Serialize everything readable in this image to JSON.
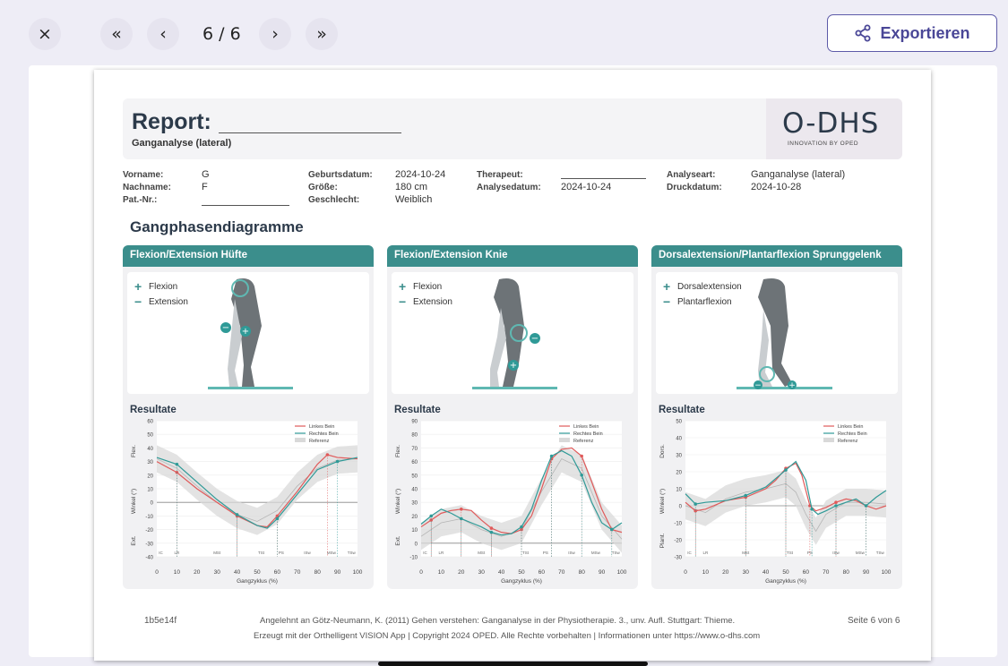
{
  "toolbar": {
    "close": "×",
    "first": "«",
    "prev": "‹",
    "page": "6 / 6",
    "next": "›",
    "last": "»",
    "export_label": "Exportieren"
  },
  "report": {
    "title": "Report:",
    "subtitle": "Ganganalyse (lateral)",
    "logo": "O-DHS",
    "logo_sub": "INNOVATION BY OPED",
    "info": {
      "vorname_label": "Vorname:",
      "vorname": "G",
      "nachname_label": "Nachname:",
      "nachname": "F",
      "patnr_label": "Pat.-Nr.:",
      "geburtsdatum_label": "Geburtsdatum:",
      "geburtsdatum": "2024-10-24",
      "groesse_label": "Größe:",
      "groesse": "180 cm",
      "geschlecht_label": "Geschlecht:",
      "geschlecht": "Weiblich",
      "therapeut_label": "Therapeut:",
      "analysedatum_label": "Analysedatum:",
      "analysedatum": "2024-10-24",
      "analyseart_label": "Analyseart:",
      "analyseart": "Ganganalyse (lateral)",
      "druckdatum_label": "Druckdatum:",
      "druckdatum": "2024-10-28"
    },
    "section_title": "Gangphasendiagramme",
    "resultate": "Resultate",
    "footer": {
      "code": "1b5e14f",
      "reference": "Angelehnt an Götz-Neumann, K. (2011) Gehen verstehen: Ganganalyse in der Physiotherapie. 3., unv. Aufl. Stuttgart: Thieme.",
      "page": "Seite 6 von 6",
      "copyright": "Erzeugt mit der Orthelligent VISION App | Copyright 2024 OPED. Alle Rechte vorbehalten | Informationen unter https://www.o-dhs.com"
    }
  },
  "panels": [
    {
      "title": "Flexion/Extension Hüfte",
      "plus": "Flexion",
      "minus": "Extension"
    },
    {
      "title": "Flexion/Extension Knie",
      "plus": "Flexion",
      "minus": "Extension"
    },
    {
      "title": "Dorsalextension/Plantarflexion Sprunggelenk",
      "plus": "Dorsalextension",
      "minus": "Plantarflexion"
    }
  ],
  "colors": {
    "left": "#e05a5a",
    "right": "#2f9a97",
    "reference": "#d9d9d9",
    "header": "#3b8e8c"
  },
  "chart_data": [
    {
      "type": "line",
      "xlabel": "Gangzyklus (%)",
      "ylabel": "Winkel (°)",
      "ylabel_top": "Flex.",
      "ylabel_bottom": "Ext.",
      "ylim": [
        -40,
        60
      ],
      "yticks": [
        -40,
        -30,
        -20,
        -10,
        0,
        10,
        20,
        30,
        40,
        50,
        60
      ],
      "xlim": [
        0,
        100
      ],
      "xticks": [
        0,
        10,
        20,
        30,
        40,
        50,
        60,
        70,
        80,
        90,
        100
      ],
      "phases": [
        "IC",
        "LR",
        "MSt",
        "TSt",
        "PS",
        "ISw",
        "MSw",
        "TSw"
      ],
      "legend": [
        "Linkes Bein",
        "Rechtes Bein",
        "Referenz"
      ],
      "series": [
        {
          "name": "Linkes Bein",
          "x": [
            0,
            10,
            20,
            30,
            40,
            50,
            55,
            60,
            70,
            80,
            85,
            90,
            100
          ],
          "y": [
            30,
            22,
            10,
            0,
            -10,
            -17,
            -18,
            -10,
            8,
            28,
            35,
            33,
            32
          ]
        },
        {
          "name": "Rechtes Bein",
          "x": [
            0,
            10,
            20,
            30,
            40,
            50,
            55,
            60,
            70,
            80,
            90,
            100
          ],
          "y": [
            33,
            28,
            15,
            2,
            -9,
            -17,
            -19,
            -12,
            6,
            24,
            30,
            33
          ]
        },
        {
          "name": "Referenz",
          "x": [
            0,
            10,
            20,
            30,
            40,
            50,
            60,
            70,
            80,
            90,
            100
          ],
          "y": [
            32,
            25,
            12,
            0,
            -9,
            -14,
            -6,
            12,
            25,
            31,
            32
          ],
          "band": 10
        }
      ]
    },
    {
      "type": "line",
      "xlabel": "Gangzyklus (%)",
      "ylabel": "Winkel (°)",
      "ylabel_top": "Flex.",
      "ylabel_bottom": "Ext.",
      "ylim": [
        -10,
        90
      ],
      "yticks": [
        -10,
        0,
        10,
        20,
        30,
        40,
        50,
        60,
        70,
        80,
        90
      ],
      "xlim": [
        0,
        100
      ],
      "xticks": [
        0,
        10,
        20,
        30,
        40,
        50,
        60,
        70,
        80,
        90,
        100
      ],
      "phases": [
        "IC",
        "LR",
        "MSt",
        "TSt",
        "PS",
        "ISw",
        "MSw",
        "TSw"
      ],
      "legend": [
        "Linkes Bein",
        "Rechtes Bein",
        "Referenz"
      ],
      "series": [
        {
          "name": "Linkes Bein",
          "x": [
            0,
            5,
            10,
            15,
            20,
            25,
            30,
            35,
            40,
            45,
            50,
            55,
            60,
            65,
            70,
            75,
            80,
            85,
            90,
            95,
            100
          ],
          "y": [
            12,
            17,
            22,
            24,
            25,
            24,
            17,
            11,
            8,
            7,
            10,
            20,
            40,
            62,
            69,
            70,
            64,
            45,
            25,
            10,
            8
          ]
        },
        {
          "name": "Rechtes Bein",
          "x": [
            0,
            5,
            10,
            15,
            20,
            25,
            30,
            35,
            40,
            45,
            50,
            55,
            60,
            65,
            70,
            75,
            80,
            85,
            90,
            95,
            100
          ],
          "y": [
            14,
            20,
            25,
            22,
            18,
            15,
            12,
            8,
            6,
            7,
            12,
            25,
            46,
            64,
            68,
            64,
            50,
            30,
            15,
            10,
            15
          ]
        },
        {
          "name": "Referenz",
          "x": [
            0,
            10,
            20,
            30,
            40,
            50,
            60,
            70,
            80,
            90,
            100
          ],
          "y": [
            5,
            15,
            18,
            10,
            5,
            10,
            38,
            62,
            55,
            20,
            3
          ],
          "band": 10
        }
      ]
    },
    {
      "type": "line",
      "xlabel": "Gangzyklus (%)",
      "ylabel": "Winkel (°)",
      "ylabel_top": "Dors.",
      "ylabel_bottom": "Plant.",
      "ylim": [
        -30,
        50
      ],
      "yticks": [
        -30,
        -20,
        -10,
        0,
        10,
        20,
        30,
        40,
        50
      ],
      "xlim": [
        0,
        100
      ],
      "xticks": [
        0,
        10,
        20,
        30,
        40,
        50,
        60,
        70,
        80,
        90,
        100
      ],
      "phases": [
        "IC",
        "LR",
        "MSt",
        "TSt",
        "PS",
        "ISw",
        "MSw",
        "TSw"
      ],
      "legend": [
        "Linkes Bein",
        "Rechtes Bein",
        "Referenz"
      ],
      "series": [
        {
          "name": "Linkes Bein",
          "x": [
            0,
            5,
            10,
            20,
            30,
            40,
            45,
            50,
            55,
            58,
            62,
            65,
            70,
            75,
            80,
            85,
            90,
            95,
            100
          ],
          "y": [
            2,
            -3,
            -2,
            3,
            5,
            10,
            15,
            22,
            25,
            18,
            0,
            -3,
            -1,
            2,
            4,
            3,
            0,
            -2,
            0
          ]
        },
        {
          "name": "Rechtes Bein",
          "x": [
            0,
            5,
            10,
            20,
            30,
            40,
            45,
            50,
            55,
            60,
            63,
            66,
            70,
            75,
            80,
            85,
            90,
            95,
            100
          ],
          "y": [
            7,
            1,
            2,
            3,
            6,
            11,
            16,
            21,
            26,
            15,
            -2,
            -5,
            -3,
            0,
            2,
            4,
            0,
            5,
            9
          ]
        },
        {
          "name": "Referenz",
          "x": [
            0,
            10,
            20,
            30,
            40,
            50,
            55,
            60,
            65,
            70,
            80,
            90,
            100
          ],
          "y": [
            0,
            -4,
            4,
            8,
            10,
            13,
            8,
            -5,
            -15,
            -5,
            2,
            2,
            1
          ],
          "band": 8
        }
      ]
    }
  ]
}
